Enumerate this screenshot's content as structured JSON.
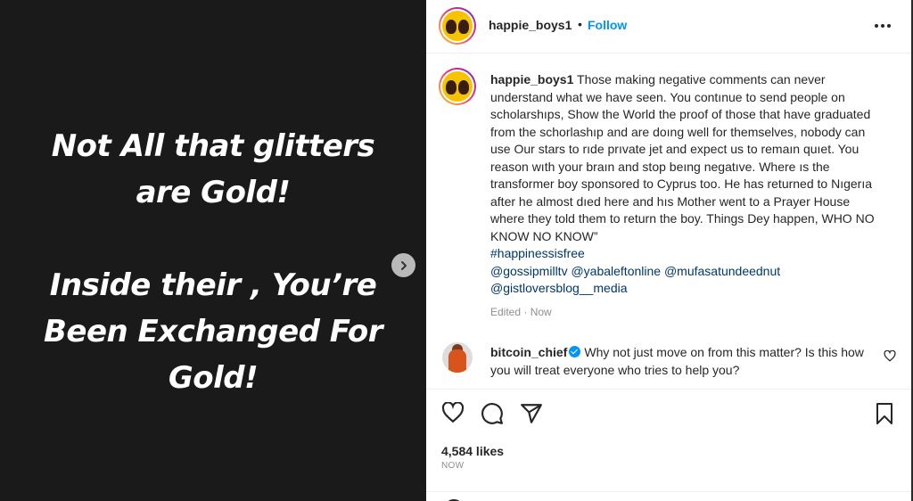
{
  "media": {
    "line1": "Not All that glitters",
    "line2": "are Gold!",
    "line3": "Inside their , You’re",
    "line4": "Been Exchanged For",
    "line5": "Gold!"
  },
  "header": {
    "username": "happie_boys1",
    "separator": "•",
    "follow_label": "Follow"
  },
  "caption": {
    "username": "happie_boys1",
    "text": " Those making negative comments can never understand what we have seen. You contınue to send people on scholarshıps, Show the World the proof of those that have graduated from the schorlashıp and are doıng well for themselves, nobody can use Our stars to rıde prıvate jet and expect us to remaın quıet. You reason wıth your braın and stop beıng negatıve. Where ıs the transformer boy sponsored to Cyprus too. He has returned to Nıgerıa after he almost dıed here and hıs Mother went to a Prayer House where they told them to return the boy. Things Dey happen, WHO NO KNOW NO KNOW”",
    "hashtag": "#happinessisfree",
    "mentions_line1": "@gossipmilltv @yabaleftonline @mufasatundeednut",
    "mentions_line2": "@gistloversblog__media",
    "edited": "Edited · Now"
  },
  "comment": {
    "username": "bitcoin_chief",
    "text": "Why not just move on from this matter? Is this how you will treat everyone who tries to help you?"
  },
  "stats": {
    "likes": "4,584 likes",
    "time": "NOW"
  },
  "icons": [
    "next-arrow-icon",
    "more-options-icon",
    "heart-icon",
    "comment-icon",
    "share-icon",
    "bookmark-icon",
    "verified-icon"
  ]
}
